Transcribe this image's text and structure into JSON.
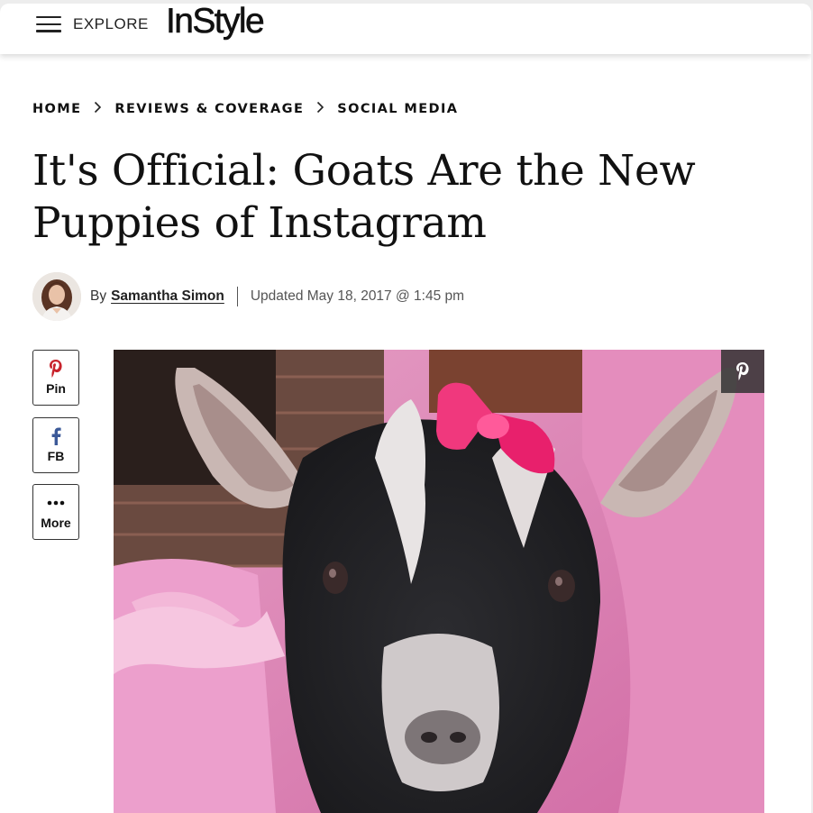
{
  "header": {
    "menu_icon": "hamburger-menu-icon",
    "explore_label": "EXPLORE",
    "logo_text": "InStyle"
  },
  "breadcrumb": {
    "items": [
      "HOME",
      "REVIEWS & COVERAGE",
      "SOCIAL MEDIA"
    ],
    "separator_icon": "chevron-right-icon"
  },
  "article": {
    "title": "It's Official: Goats Are the New Puppies of Instagram",
    "byline_prefix": "By",
    "author": "Samantha Simon",
    "updated": "Updated May 18, 2017 @ 1:45 pm"
  },
  "share": {
    "buttons": [
      {
        "label": "Pin",
        "icon": "pinterest-icon",
        "color": "#c8232c"
      },
      {
        "label": "FB",
        "icon": "facebook-icon",
        "color": "#3b5998"
      },
      {
        "label": "More",
        "icon": "more-dots-icon",
        "color": "#111111"
      }
    ]
  },
  "hero": {
    "image": "goat-kid-with-pink-bow-photo",
    "pin_icon": "pinterest-icon"
  },
  "colors": {
    "accent": "#111111",
    "background": "#ffffff",
    "pinterest": "#c8232c",
    "facebook": "#3b5998"
  }
}
